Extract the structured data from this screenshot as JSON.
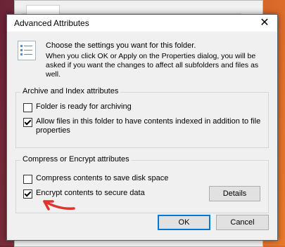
{
  "dialog": {
    "title": "Advanced Attributes",
    "close_symbol": "✕",
    "intro_line": "Choose the settings you want for this folder.",
    "intro_sub": "When you click OK or Apply on the Properties dialog, you will be asked if you want the changes to affect all subfolders and files as well."
  },
  "archive_group": {
    "legend": "Archive and Index attributes",
    "items": [
      {
        "label": "Folder is ready for archiving",
        "checked": false
      },
      {
        "label": "Allow files in this folder to have contents indexed in addition to file properties",
        "checked": true
      }
    ]
  },
  "compress_group": {
    "legend": "Compress or Encrypt attributes",
    "items": [
      {
        "label": "Compress contents to save disk space",
        "checked": false
      },
      {
        "label": "Encrypt contents to secure data",
        "checked": true
      }
    ],
    "details_label": "Details"
  },
  "buttons": {
    "ok_label": "OK",
    "cancel_label": "Cancel"
  },
  "annotation_color": "#e0342e"
}
